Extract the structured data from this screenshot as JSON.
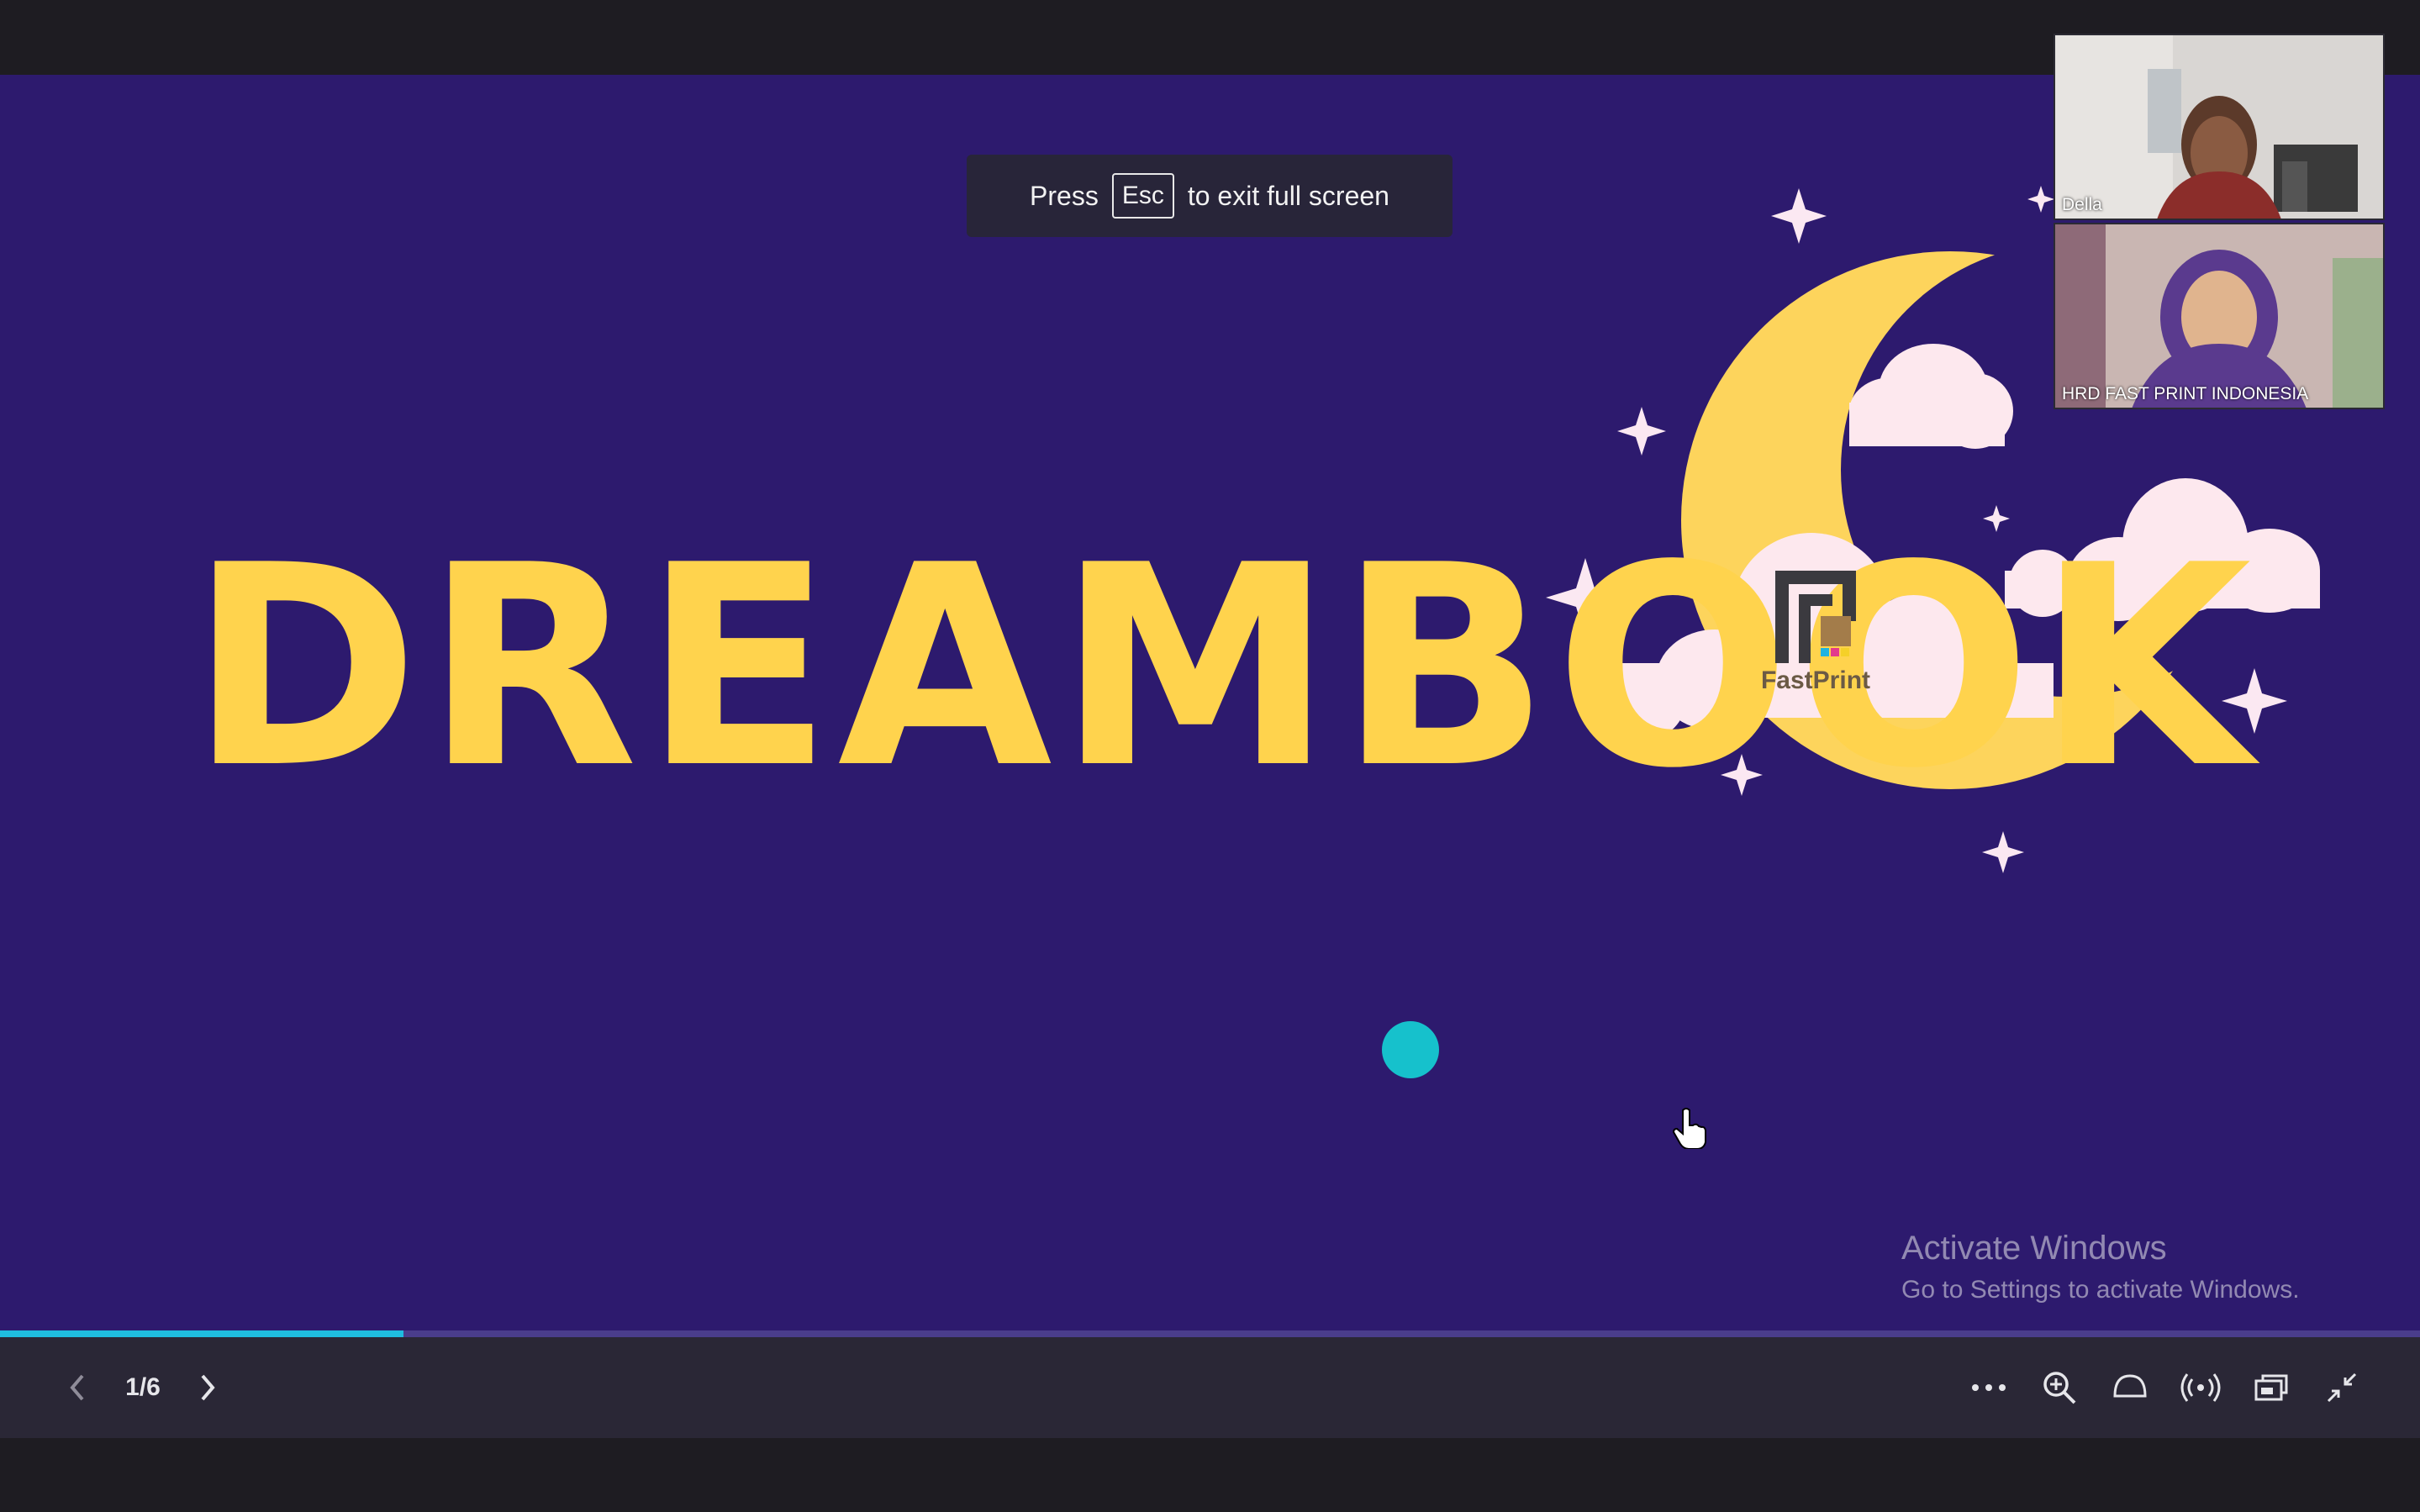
{
  "esc_hint": {
    "press": "Press",
    "key": "Esc",
    "rest": "to exit full screen"
  },
  "slide": {
    "title": "DREAMBOOK",
    "logo_text": "FastPrint",
    "background_color": "#2d1a6e",
    "title_color": "#ffd34d",
    "accent_dot_color": "#16c1cc"
  },
  "participants": [
    {
      "name": "Della"
    },
    {
      "name": "HRD FAST PRINT INDONESIA"
    }
  ],
  "watermark": {
    "line1": "Activate Windows",
    "line2": "Go to Settings to activate Windows."
  },
  "player": {
    "page_counter": "1/6",
    "progress_fraction": 0.1667,
    "icons": [
      "chevron-left-icon",
      "chevron-right-icon",
      "more-icon",
      "zoom-in-icon",
      "laser-pointer-icon",
      "broadcast-icon",
      "pop-out-icon",
      "exit-fullscreen-icon"
    ]
  }
}
